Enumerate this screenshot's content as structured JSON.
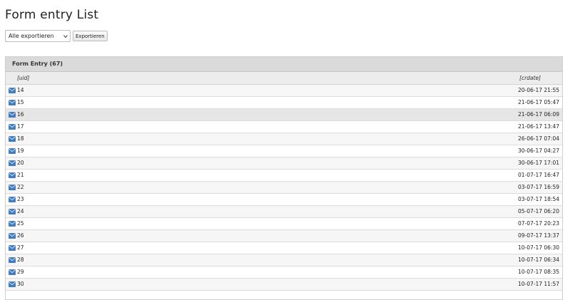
{
  "page": {
    "title": "Form entry List"
  },
  "export": {
    "select_value": "Alle exportieren",
    "button_label": "Exportieren"
  },
  "panel": {
    "title": "Form Entry (67)",
    "col_uid": "[uid]",
    "col_crdate": "[crdate]"
  },
  "rows": [
    {
      "uid": "14",
      "crdate": "20-06-17 21:55"
    },
    {
      "uid": "15",
      "crdate": "21-06-17 05:47"
    },
    {
      "uid": "16",
      "crdate": "21-06-17 06:09"
    },
    {
      "uid": "17",
      "crdate": "21-06-17 13:47"
    },
    {
      "uid": "18",
      "crdate": "26-06-17 07:04"
    },
    {
      "uid": "19",
      "crdate": "30-06-17 04:27"
    },
    {
      "uid": "20",
      "crdate": "30-06-17 17:01"
    },
    {
      "uid": "21",
      "crdate": "01-07-17 16:47"
    },
    {
      "uid": "22",
      "crdate": "03-07-17 16:59"
    },
    {
      "uid": "23",
      "crdate": "03-07-17 18:54"
    },
    {
      "uid": "24",
      "crdate": "05-07-17 06:20"
    },
    {
      "uid": "25",
      "crdate": "07-07-17 20:23"
    },
    {
      "uid": "26",
      "crdate": "09-07-17 13:37"
    },
    {
      "uid": "27",
      "crdate": "10-07-17 06:30"
    },
    {
      "uid": "28",
      "crdate": "10-07-17 06:34"
    },
    {
      "uid": "29",
      "crdate": "10-07-17 08:35"
    },
    {
      "uid": "30",
      "crdate": "10-07-17 11:57"
    }
  ],
  "colors": {
    "envelope": "#3a7cc9",
    "header_bg": "#dadada"
  },
  "icons": {
    "row_icon": "envelope-icon",
    "select_icon": "chevron-down-icon"
  }
}
